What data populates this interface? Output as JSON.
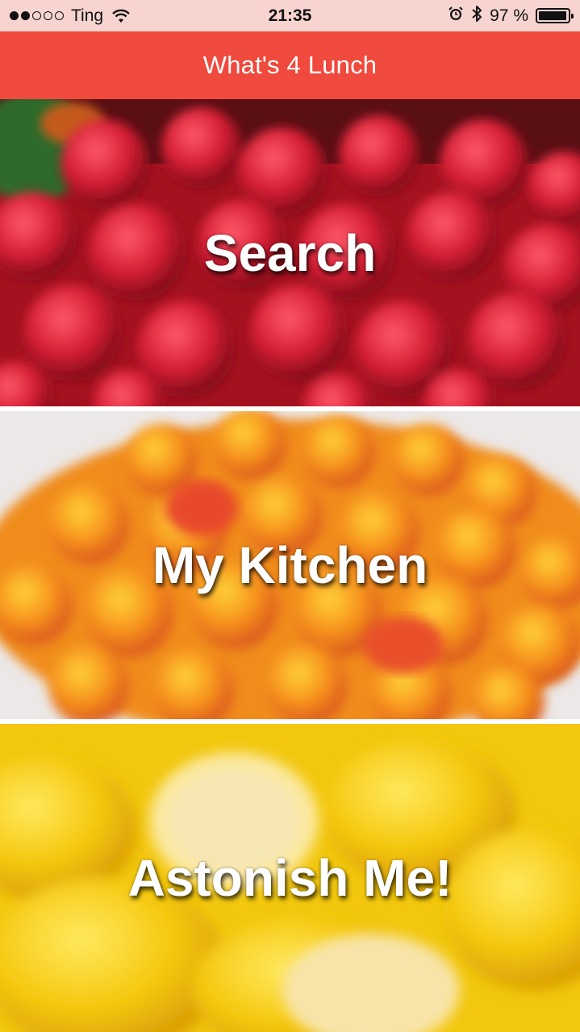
{
  "status_bar": {
    "carrier": "Ting",
    "time": "21:35",
    "battery_text": "97 %",
    "battery_level": 0.97,
    "signal_bars_filled": 2,
    "signal_bars_total": 5,
    "icons": [
      "wifi-icon",
      "alarm-icon",
      "bluetooth-icon",
      "battery-icon"
    ]
  },
  "nav": {
    "title": "What's 4 Lunch",
    "background_color": "#f0493d"
  },
  "tiles": [
    {
      "label": "Search",
      "theme": "raspberries",
      "color": "#b8182a"
    },
    {
      "label": "My Kitchen",
      "theme": "cloudberries",
      "color": "#f2921a"
    },
    {
      "label": "Astonish Me!",
      "theme": "lemons",
      "color": "#f0c50c"
    }
  ]
}
